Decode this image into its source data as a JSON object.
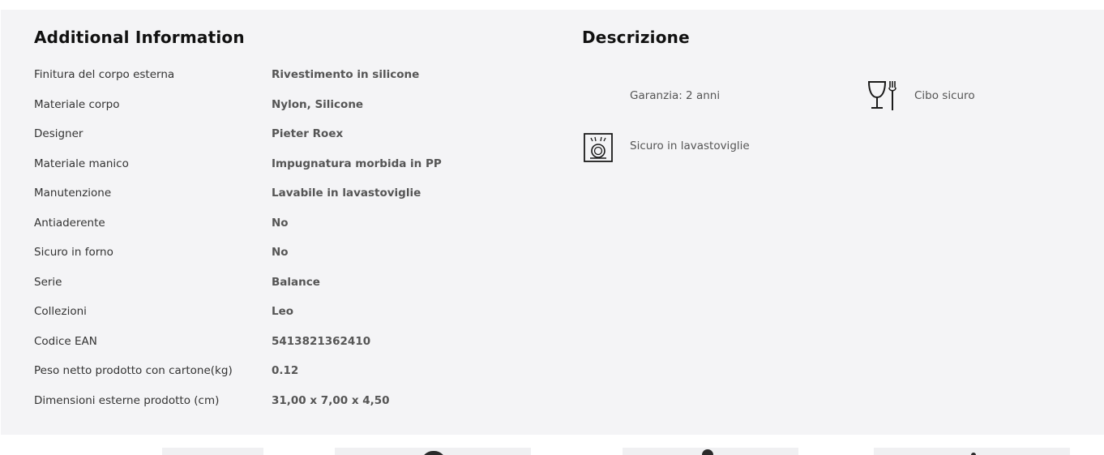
{
  "additional_info": {
    "title": "Additional Information",
    "rows": [
      {
        "label": "Finitura del corpo esterna",
        "value": "Rivestimento in silicone"
      },
      {
        "label": "Materiale corpo",
        "value": "Nylon, Silicone"
      },
      {
        "label": "Designer",
        "value": "Pieter Roex"
      },
      {
        "label": "Materiale manico",
        "value": "Impugnatura morbida in PP"
      },
      {
        "label": "Manutenzione",
        "value": "Lavabile in lavastoviglie"
      },
      {
        "label": "Antiaderente",
        "value": "No"
      },
      {
        "label": "Sicuro in forno",
        "value": "No"
      },
      {
        "label": "Serie",
        "value": "Balance"
      },
      {
        "label": "Collezioni",
        "value": "Leo"
      },
      {
        "label": "Codice EAN",
        "value": "5413821362410"
      },
      {
        "label": "Peso netto prodotto con cartone(kg)",
        "value": "0.12"
      },
      {
        "label": "Dimensioni esterne prodotto (cm)",
        "value": "31,00 x 7,00 x 4,50"
      }
    ]
  },
  "descrizione": {
    "title": "Descrizione",
    "features": {
      "warranty": {
        "text": "Garanzia: 2 anni"
      },
      "food_safe": {
        "icon": "food-safe-icon",
        "text": "Cibo sicuro"
      },
      "dishwasher": {
        "icon": "dishwasher-safe-icon",
        "text": "Sicuro in lavastoviglie"
      }
    }
  },
  "colors": {
    "panel_background": "#f4f4f6",
    "heading": "#111111",
    "label": "#333333",
    "value": "#555555"
  }
}
